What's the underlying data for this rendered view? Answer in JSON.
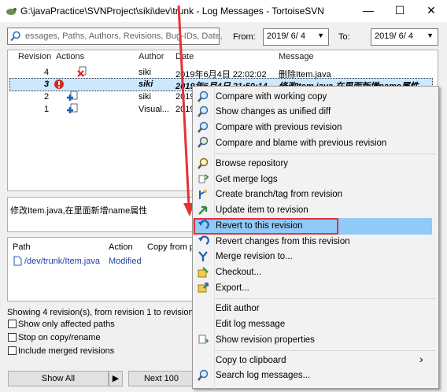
{
  "window": {
    "title": "G:\\javaPractice\\SVNProject\\siki\\dev\\trunk - Log Messages - TortoiseSVN",
    "minimize": "—",
    "maximize": "☐",
    "close": "✕"
  },
  "filter": {
    "placeholder": "essages, Paths, Authors, Revisions, Bug-IDs, Date,",
    "from_label": "From:",
    "from_value": "2019/ 6/ 4",
    "to_label": "To:",
    "to_value": "2019/ 6/ 4"
  },
  "columns": [
    "Revision",
    "Actions",
    "Author",
    "Date",
    "Message"
  ],
  "rows": [
    {
      "revision": "4",
      "author": "siki",
      "date": "2019年6月4日 22:02:02",
      "message": "删除Item.java"
    },
    {
      "revision": "3",
      "author": "siki",
      "date": "2019年6月4日 21:50:14",
      "message": "修改Item.java,在里面新增name属性"
    },
    {
      "revision": "2",
      "author": "siki",
      "date": "2019",
      "message": ""
    },
    {
      "revision": "1",
      "author": "Visual...",
      "date": "2019",
      "message": ""
    }
  ],
  "log_message": "修改Item.java,在里面新增name属性",
  "path_columns": [
    "Path",
    "Action",
    "Copy from pa"
  ],
  "path_rows": [
    {
      "path": "/dev/trunk/Item.java",
      "action": "Modified"
    }
  ],
  "status_text": "Showing 4 revision(s), from revision 1 to revision 4 - 1",
  "options": {
    "show_affected": "Show only affected paths",
    "stop_on_copy": "Stop on copy/rename",
    "include_merged": "Include merged revisions"
  },
  "buttons": {
    "show_all": "Show All",
    "show_all_arrow": "▶",
    "next_100": "Next 100"
  },
  "context_menu": {
    "items": [
      {
        "label": "Compare with working copy",
        "icon": "magnifier-icon"
      },
      {
        "label": "Show changes as unified diff",
        "icon": "magnifier-icon"
      },
      {
        "label": "Compare with previous revision",
        "icon": "magnifier-icon"
      },
      {
        "label": "Compare and blame with previous revision",
        "icon": "magnifier-blame-icon"
      },
      {
        "label": "Browse repository",
        "icon": "repo-browser-icon"
      },
      {
        "label": "Get merge logs",
        "icon": "merge-log-icon"
      },
      {
        "label": "Create branch/tag from revision",
        "icon": "branch-icon"
      },
      {
        "label": "Update item to revision",
        "icon": "update-icon"
      },
      {
        "label": "Revert to this revision",
        "icon": "revert-icon"
      },
      {
        "label": "Revert changes from this revision",
        "icon": "revert-icon"
      },
      {
        "label": "Merge revision to...",
        "icon": "merge-icon"
      },
      {
        "label": "Checkout...",
        "icon": "checkout-icon"
      },
      {
        "label": "Export...",
        "icon": "export-icon"
      },
      {
        "label": "Edit author",
        "icon": ""
      },
      {
        "label": "Edit log message",
        "icon": ""
      },
      {
        "label": "Show revision properties",
        "icon": "properties-icon"
      },
      {
        "label": "Copy to clipboard",
        "icon": ""
      },
      {
        "label": "Search log messages...",
        "icon": "search-icon"
      }
    ],
    "submenu_arrow": "›"
  },
  "colors": {
    "highlight": "#91c9f7",
    "annotation": "#e53238",
    "selection": "#cce8ff"
  }
}
